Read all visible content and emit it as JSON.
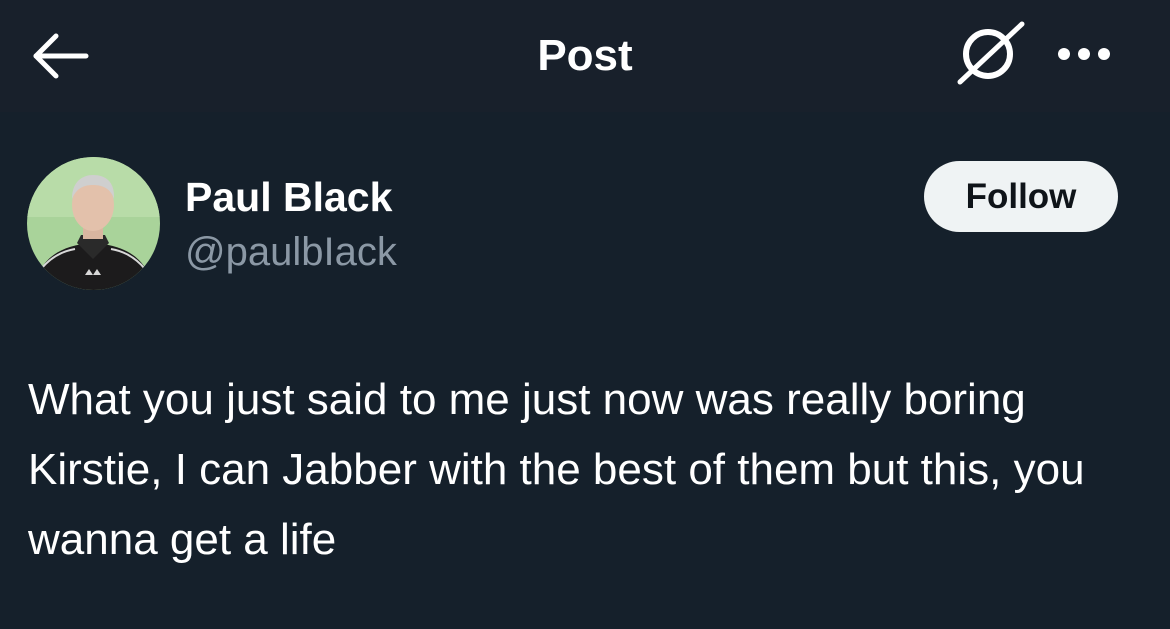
{
  "header": {
    "title": "Post",
    "back_icon": "arrow-left-icon",
    "grok_icon": "grok-slash-circle-icon",
    "more_icon": "more-dots-icon"
  },
  "author": {
    "display_name": "Paul Black",
    "handle": "@paulbIack",
    "avatar_icon": "avatar-photo"
  },
  "follow_button": {
    "label": "Follow"
  },
  "post": {
    "text": "What you just said to me just now was really boring Kirstie, I can Jabber with the best of them but this, you wanna get a life"
  },
  "colors": {
    "background": "#15202b",
    "header_background": "#18202b",
    "handle_gray": "#8b98a5",
    "follow_bg": "#eff3f4",
    "follow_text": "#0f1419"
  }
}
